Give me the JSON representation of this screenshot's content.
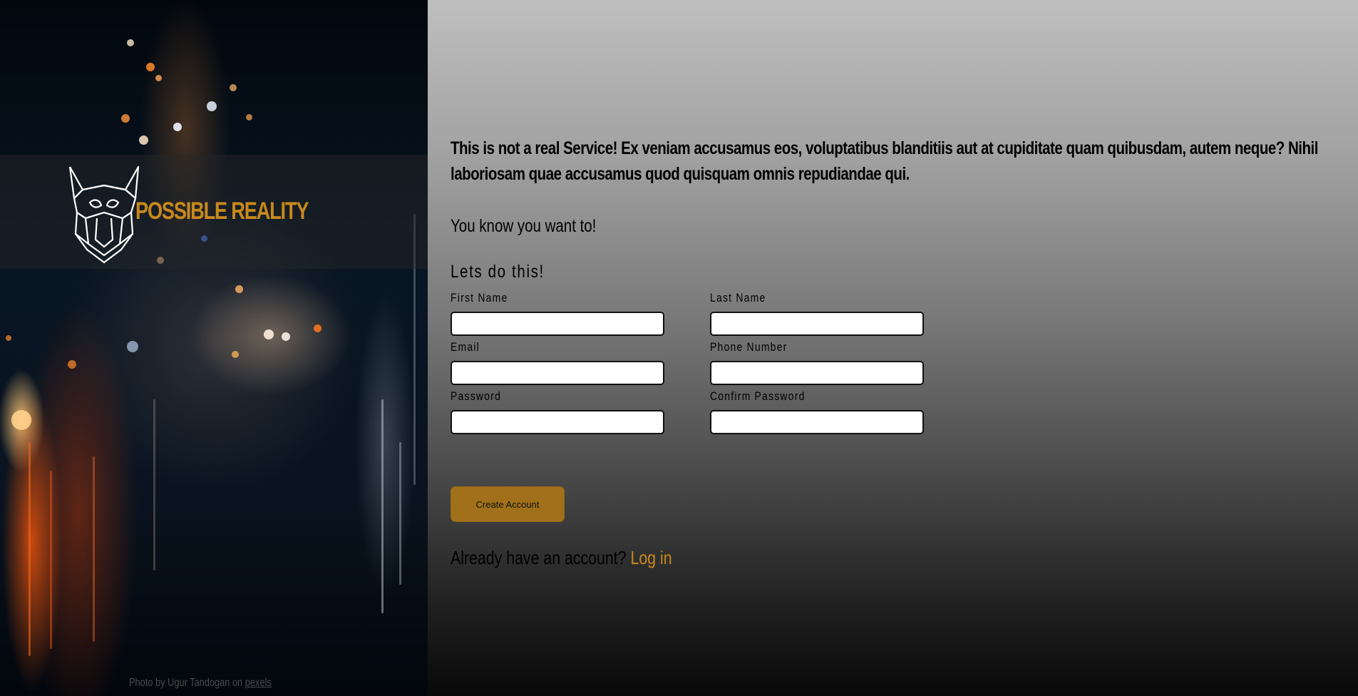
{
  "brand": {
    "name": "POSSIBLE REALITY",
    "logo_icon": "viking-helmet-icon",
    "accent_color": "#c8891c"
  },
  "hero": {
    "credit_prefix": "Photo by Ugur Tandogan on",
    "credit_link": "pexels"
  },
  "main": {
    "intro": "This is not a real Service! Ex veniam accusamus eos, voluptatibus blanditiis aut at cupiditate quam quibusdam, autem neque? Nihil laboriosam quae accusamus quod quisquam omnis repudiandae qui.",
    "tagline": "You know you want to!",
    "form_title": "Lets do this!"
  },
  "form": {
    "first_name": {
      "label": "First Name",
      "value": ""
    },
    "last_name": {
      "label": "Last Name",
      "value": ""
    },
    "email": {
      "label": "Email",
      "value": ""
    },
    "phone": {
      "label": "Phone Number",
      "value": ""
    },
    "password": {
      "label": "Password",
      "value": ""
    },
    "confirm_password": {
      "label": "Confirm Password",
      "value": ""
    },
    "submit_label": "Create Account"
  },
  "login": {
    "prompt": "Already have an account?",
    "link_label": "Log in"
  }
}
